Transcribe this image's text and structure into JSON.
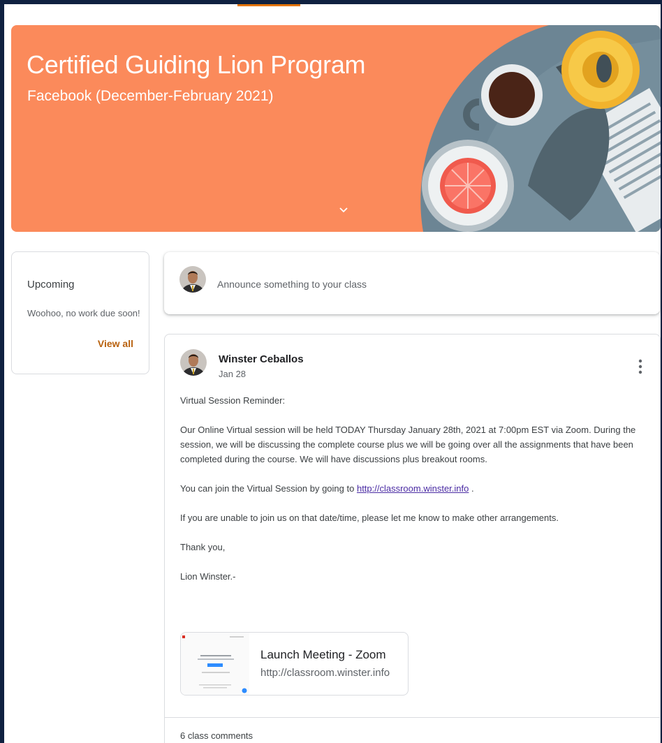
{
  "banner": {
    "title": "Certified Guiding Lion Program",
    "subtitle": "Facebook (December-February 2021)",
    "color": "#fb8a5b",
    "expand_icon": "chevron-down-icon"
  },
  "upcoming": {
    "title": "Upcoming",
    "empty_text": "Woohoo, no work due soon!",
    "view_all_label": "View all"
  },
  "announce": {
    "placeholder": "Announce something to your class"
  },
  "post": {
    "author": "Winster Ceballos",
    "date": "Jan 28",
    "menu_icon": "more-vert-icon",
    "heading": "Virtual Session Reminder:",
    "paragraph1": "Our Online Virtual session will be held TODAY Thursday January 28th, 2021 at 7:00pm EST via Zoom. During the session, we will be discussing the complete course plus we will be going over all the assignments that have been completed during the course. We will have discussions plus breakout rooms.",
    "join_prefix": "You can join the Virtual Session by going to ",
    "join_link": "http://classroom.winster.info",
    "join_suffix": " .",
    "paragraph3": "If you are unable to join us on that date/time, please let me know to make other arrangements.",
    "thanks": "Thank you,",
    "signature": "Lion Winster.-",
    "attachment": {
      "title": "Launch Meeting - Zoom",
      "url": "http://classroom.winster.info"
    },
    "comments_label": "6 class comments"
  },
  "colors": {
    "accent": "#b8610e",
    "link": "#4a2ba3",
    "frame": "#0f2140"
  }
}
